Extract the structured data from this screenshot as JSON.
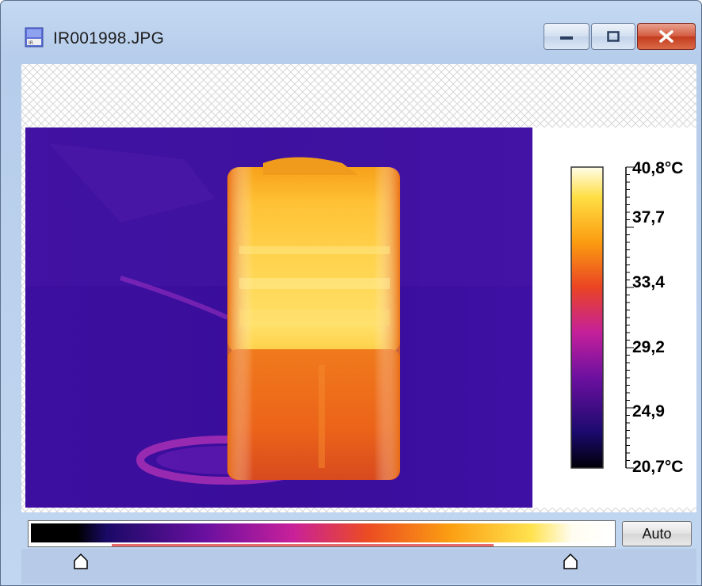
{
  "window": {
    "title": "IR001998.JPG",
    "accent_color": "#c23b1f",
    "icons": {
      "app": "image-file-icon",
      "minimize": "minimize-icon",
      "maximize": "maximize-icon",
      "close": "close-icon"
    }
  },
  "temperature_scale": {
    "max_label": "40,8°C",
    "labels": [
      "37,7",
      "33,4",
      "29,2",
      "24,9"
    ],
    "min_label": "20,7°C",
    "palette": "iron"
  },
  "palette_control": {
    "auto_label": "Auto",
    "lower_slider_icon": "slider-handle-icon",
    "upper_slider_icon": "slider-handle-icon",
    "range_color": "#e86a6a"
  }
}
